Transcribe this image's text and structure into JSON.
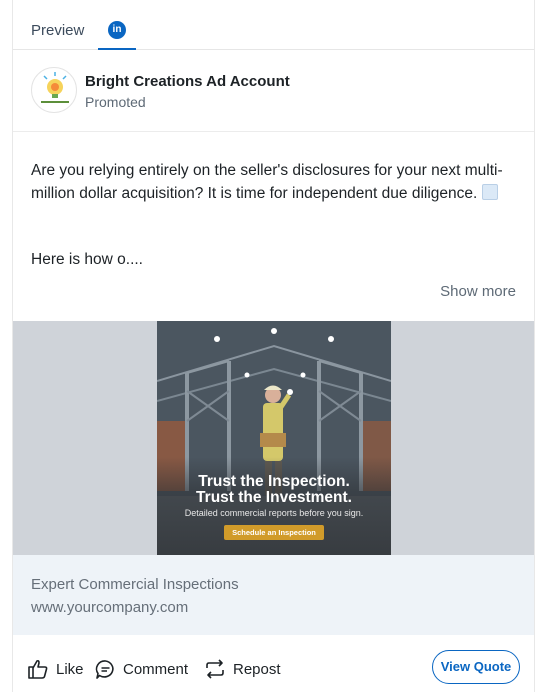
{
  "tabs": {
    "preview_label": "Preview",
    "network_badge": "in"
  },
  "post": {
    "account_name": "Bright Creations Ad Account",
    "status": "Promoted",
    "body": "Are you relying entirely on the seller's disclosures for your next multi-million dollar acquisition? It is time for independent due diligence.",
    "hook": "Here is how o....",
    "show_more": "Show more"
  },
  "creative": {
    "headline_1": "Trust the Inspection.",
    "headline_2": "Trust the Investment.",
    "subline": "Detailed commercial reports before you sign.",
    "cta": "Schedule an Inspection"
  },
  "ad_footer": {
    "title": "Expert Commercial Inspections",
    "url": "www.yourcompany.com"
  },
  "actions": {
    "like": "Like",
    "comment": "Comment",
    "repost": "Repost",
    "cta": "View Quote"
  },
  "colors": {
    "brand": "#0a66c2",
    "cta_gold": "#d19b2a"
  },
  "icons": {
    "network": "linkedin-icon",
    "emoji": "chart-decreasing-emoji",
    "like": "thumbs-up-icon",
    "comment": "comment-icon",
    "repost": "repost-icon"
  }
}
